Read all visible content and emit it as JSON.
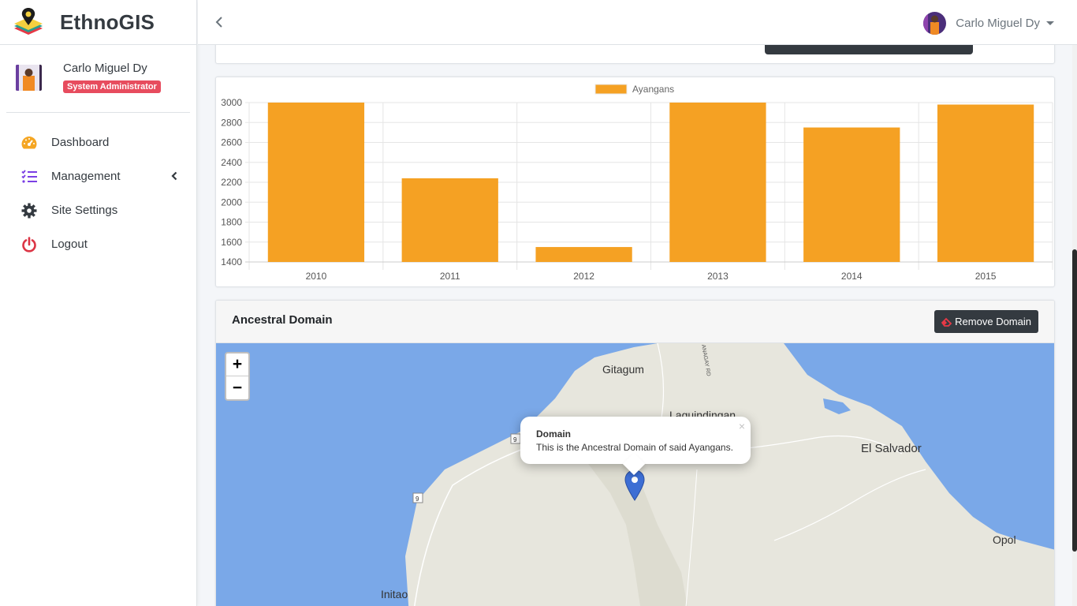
{
  "brand": {
    "name": "EthnoGIS"
  },
  "sidebar": {
    "user": {
      "name": "Carlo Miguel Dy",
      "role": "System Administrator"
    },
    "items": [
      {
        "label": "Dashboard",
        "icon": "dashboard-gauge-icon",
        "color": "#f5a623"
      },
      {
        "label": "Management",
        "icon": "list-check-icon",
        "color": "#7b3fe4"
      },
      {
        "label": "Site Settings",
        "icon": "gear-icon",
        "color": "#343a40"
      },
      {
        "label": "Logout",
        "icon": "power-icon",
        "color": "#dc3545"
      }
    ]
  },
  "topbar": {
    "user_name": "Carlo Miguel Dy"
  },
  "colors": {
    "bar": "#f5a123",
    "role_badge": "#e74c5e",
    "dark_button": "#343a40",
    "map_water": "#7aa8e8",
    "map_land": "#e7e6dd"
  },
  "chart_data": {
    "type": "bar",
    "categories": [
      "2010",
      "2011",
      "2012",
      "2013",
      "2014",
      "2015"
    ],
    "series": [
      {
        "name": "Ayangans",
        "values": [
          3000,
          2240,
          1550,
          3000,
          2750,
          2980
        ]
      }
    ],
    "yticks": [
      1400,
      1600,
      1800,
      2000,
      2200,
      2400,
      2600,
      2800,
      3000
    ],
    "ylim": [
      1400,
      3000
    ],
    "grid": true,
    "legend": "top-center"
  },
  "domain_card": {
    "title": "Ancestral Domain",
    "remove_label": "Remove Domain"
  },
  "map": {
    "zoom_in": "+",
    "zoom_out": "−",
    "places": [
      "Gitagum",
      "Laguindingan",
      "El Salvador",
      "Opol",
      "Initao"
    ],
    "road_labels": [
      "9",
      "9"
    ],
    "road_name": "ANAGAY RD",
    "popup": {
      "title": "Domain",
      "text": "This is the Ancestral Domain of said Ayangans.",
      "close": "×"
    }
  }
}
